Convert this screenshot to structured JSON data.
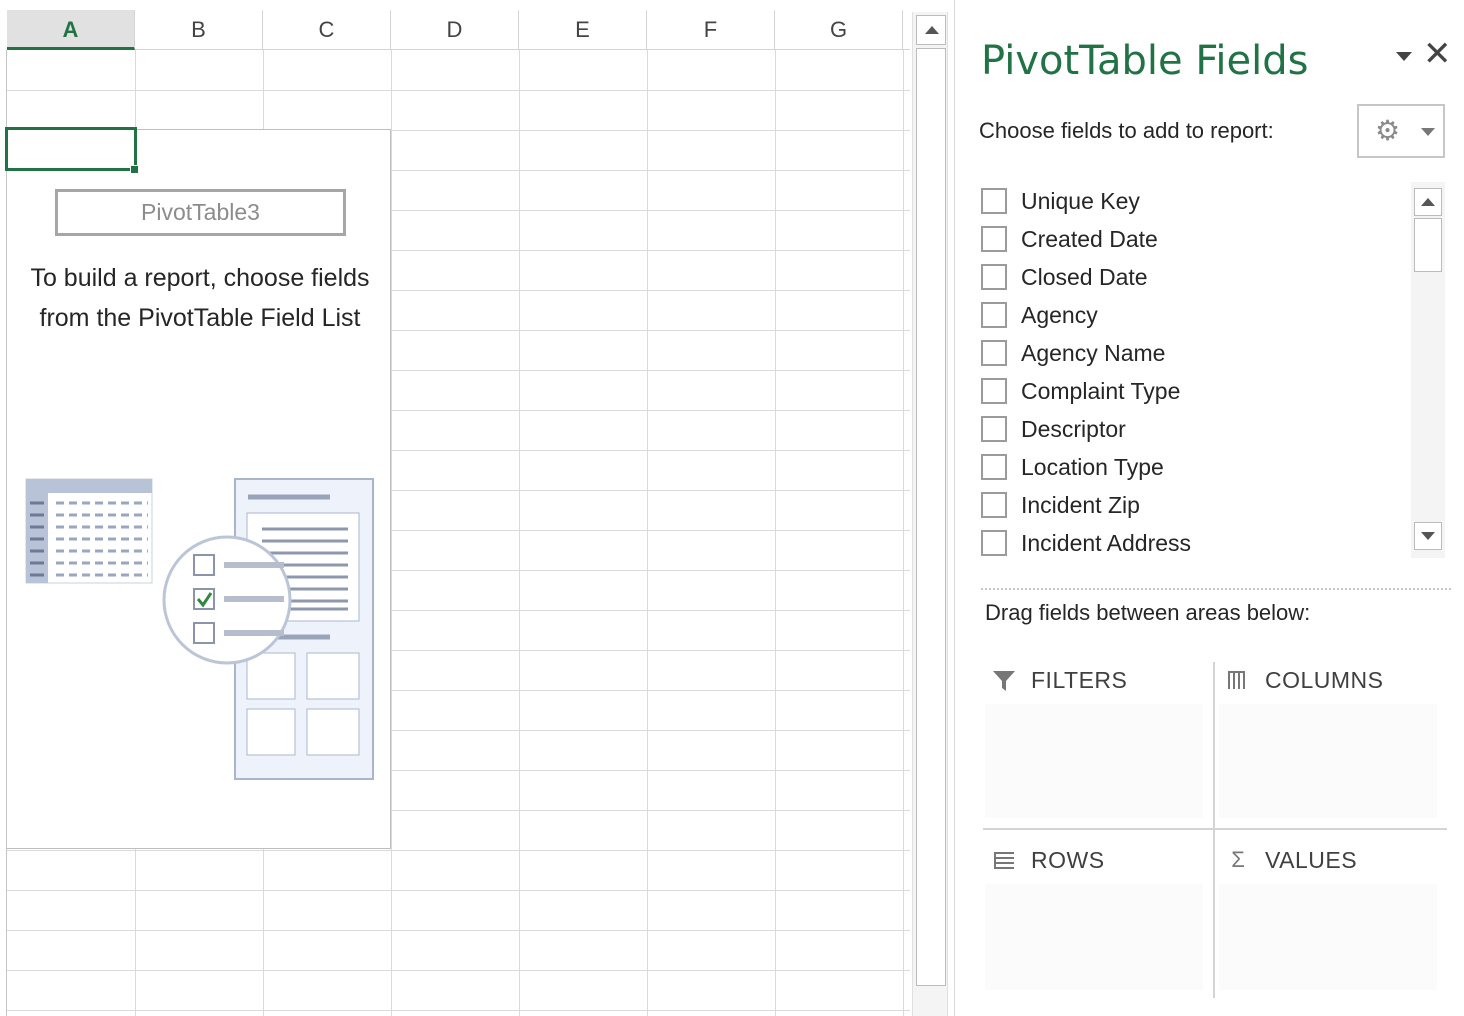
{
  "sheet": {
    "columns": [
      "A",
      "B",
      "C",
      "D",
      "E",
      "F",
      "G"
    ],
    "active_column": "A"
  },
  "pivot": {
    "name": "PivotTable3",
    "instruction": "To build a report, choose fields from the PivotTable Field List"
  },
  "pane": {
    "title": "PivotTable Fields",
    "close_glyph": "✕",
    "choose_label": "Choose fields to add to report:",
    "tools_icon": "gear-icon",
    "fields": [
      {
        "label": "Unique Key",
        "checked": false
      },
      {
        "label": "Created Date",
        "checked": false
      },
      {
        "label": "Closed Date",
        "checked": false
      },
      {
        "label": "Agency",
        "checked": false
      },
      {
        "label": "Agency Name",
        "checked": false
      },
      {
        "label": "Complaint Type",
        "checked": false
      },
      {
        "label": "Descriptor",
        "checked": false
      },
      {
        "label": "Location Type",
        "checked": false
      },
      {
        "label": "Incident Zip",
        "checked": false
      },
      {
        "label": "Incident Address",
        "checked": false
      }
    ],
    "drag_label": "Drag fields between areas below:",
    "areas": {
      "filters": {
        "label": "FILTERS",
        "icon": "filter-icon"
      },
      "columns": {
        "label": "COLUMNS",
        "icon": "columns-icon"
      },
      "rows": {
        "label": "ROWS",
        "icon": "rows-icon"
      },
      "values": {
        "label": "VALUES",
        "icon": "sigma-icon"
      }
    }
  },
  "colors": {
    "accent": "#217346",
    "gridline": "#dadada"
  }
}
